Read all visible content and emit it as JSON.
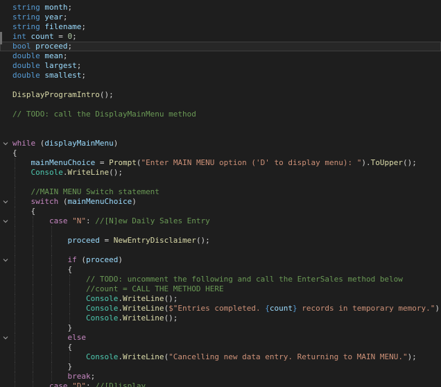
{
  "editor": {
    "background": "#1e1e1e",
    "colors": {
      "kw": "#569cd6",
      "ctl": "#c586c0",
      "var": "#9cdcfe",
      "fn": "#dcdcaa",
      "cls": "#4ec9b0",
      "com": "#6a9955",
      "str": "#ce9178",
      "num": "#b5cea8",
      "pun": "#d4d4d4"
    },
    "lines": [
      {
        "tokens": [
          {
            "t": "string",
            "c": "kw"
          },
          {
            "t": " month",
            "c": "var"
          },
          {
            "t": ";",
            "c": "pun"
          }
        ]
      },
      {
        "tokens": [
          {
            "t": "string",
            "c": "kw"
          },
          {
            "t": " year",
            "c": "var"
          },
          {
            "t": ";",
            "c": "pun"
          }
        ]
      },
      {
        "tokens": [
          {
            "t": "string",
            "c": "kw"
          },
          {
            "t": " filename",
            "c": "var"
          },
          {
            "t": ";",
            "c": "pun"
          }
        ]
      },
      {
        "tokens": [
          {
            "t": "int",
            "c": "kw"
          },
          {
            "t": " count",
            "c": "var"
          },
          {
            "t": " = ",
            "c": "pun"
          },
          {
            "t": "0",
            "c": "num"
          },
          {
            "t": ";",
            "c": "pun"
          }
        ]
      },
      {
        "highlight": true,
        "tokens": [
          {
            "t": "bool",
            "c": "kw"
          },
          {
            "t": " proceed",
            "c": "var"
          },
          {
            "t": ";",
            "c": "pun"
          }
        ]
      },
      {
        "tokens": [
          {
            "t": "double",
            "c": "kw"
          },
          {
            "t": " mean",
            "c": "var"
          },
          {
            "t": ";",
            "c": "pun"
          }
        ]
      },
      {
        "tokens": [
          {
            "t": "double",
            "c": "kw"
          },
          {
            "t": " largest",
            "c": "var"
          },
          {
            "t": ";",
            "c": "pun"
          }
        ]
      },
      {
        "tokens": [
          {
            "t": "double",
            "c": "kw"
          },
          {
            "t": " smallest",
            "c": "var"
          },
          {
            "t": ";",
            "c": "pun"
          }
        ]
      },
      {
        "tokens": []
      },
      {
        "tokens": [
          {
            "t": "DisplayProgramIntro",
            "c": "fn"
          },
          {
            "t": "();",
            "c": "pun"
          }
        ]
      },
      {
        "tokens": []
      },
      {
        "tokens": [
          {
            "t": "// TODO: call the DisplayMainMenu method",
            "c": "com"
          }
        ]
      },
      {
        "tokens": []
      },
      {
        "tokens": []
      },
      {
        "fold": true,
        "tokens": [
          {
            "t": "while",
            "c": "ctl"
          },
          {
            "t": " (",
            "c": "pun"
          },
          {
            "t": "displayMainMenu",
            "c": "var"
          },
          {
            "t": ")",
            "c": "pun"
          }
        ]
      },
      {
        "tokens": [
          {
            "t": "{",
            "c": "pun"
          }
        ]
      },
      {
        "indent": 4,
        "guides": 1,
        "tokens": [
          {
            "t": "mainMenuChoice",
            "c": "var"
          },
          {
            "t": " = ",
            "c": "pun"
          },
          {
            "t": "Prompt",
            "c": "fn"
          },
          {
            "t": "(",
            "c": "pun"
          },
          {
            "t": "\"Enter MAIN MENU option ('D' to display menu): \"",
            "c": "str"
          },
          {
            "t": ").",
            "c": "pun"
          },
          {
            "t": "ToUpper",
            "c": "fn"
          },
          {
            "t": "();",
            "c": "pun"
          }
        ]
      },
      {
        "indent": 4,
        "guides": 1,
        "tokens": [
          {
            "t": "Console",
            "c": "cls"
          },
          {
            "t": ".",
            "c": "pun"
          },
          {
            "t": "WriteLine",
            "c": "fn"
          },
          {
            "t": "();",
            "c": "pun"
          }
        ]
      },
      {
        "guides": 1,
        "tokens": []
      },
      {
        "indent": 4,
        "guides": 1,
        "tokens": [
          {
            "t": "//MAIN MENU Switch statement",
            "c": "com"
          }
        ]
      },
      {
        "indent": 4,
        "guides": 1,
        "fold": true,
        "tokens": [
          {
            "t": "switch",
            "c": "ctl"
          },
          {
            "t": " (",
            "c": "pun"
          },
          {
            "t": "mainMenuChoice",
            "c": "var"
          },
          {
            "t": ")",
            "c": "pun"
          }
        ]
      },
      {
        "indent": 4,
        "guides": 1,
        "tokens": [
          {
            "t": "{",
            "c": "pun"
          }
        ]
      },
      {
        "indent": 8,
        "guides": 2,
        "fold": true,
        "tokens": [
          {
            "t": "case",
            "c": "ctl"
          },
          {
            "t": " \"N\"",
            "c": "str"
          },
          {
            "t": ": ",
            "c": "pun"
          },
          {
            "t": "//[N]ew Daily Sales Entry",
            "c": "com"
          }
        ]
      },
      {
        "guides": 3,
        "tokens": []
      },
      {
        "indent": 12,
        "guides": 3,
        "tokens": [
          {
            "t": "proceed",
            "c": "var"
          },
          {
            "t": " = ",
            "c": "pun"
          },
          {
            "t": "NewEntryDisclaimer",
            "c": "fn"
          },
          {
            "t": "();",
            "c": "pun"
          }
        ]
      },
      {
        "guides": 3,
        "tokens": []
      },
      {
        "indent": 12,
        "guides": 3,
        "fold": true,
        "tokens": [
          {
            "t": "if",
            "c": "ctl"
          },
          {
            "t": " (",
            "c": "pun"
          },
          {
            "t": "proceed",
            "c": "var"
          },
          {
            "t": ")",
            "c": "pun"
          }
        ]
      },
      {
        "indent": 12,
        "guides": 3,
        "tokens": [
          {
            "t": "{",
            "c": "pun"
          }
        ]
      },
      {
        "indent": 16,
        "guides": 4,
        "tokens": [
          {
            "t": "// TODO: uncomment the following and call the EnterSales method below",
            "c": "com"
          }
        ]
      },
      {
        "indent": 16,
        "guides": 4,
        "tokens": [
          {
            "t": "//count = CALL THE METHOD HERE",
            "c": "com"
          }
        ]
      },
      {
        "indent": 16,
        "guides": 4,
        "tokens": [
          {
            "t": "Console",
            "c": "cls"
          },
          {
            "t": ".",
            "c": "pun"
          },
          {
            "t": "WriteLine",
            "c": "fn"
          },
          {
            "t": "();",
            "c": "pun"
          }
        ]
      },
      {
        "indent": 16,
        "guides": 4,
        "tokens": [
          {
            "t": "Console",
            "c": "cls"
          },
          {
            "t": ".",
            "c": "pun"
          },
          {
            "t": "WriteLine",
            "c": "fn"
          },
          {
            "t": "(",
            "c": "pun"
          },
          {
            "t": "$\"Entries completed. ",
            "c": "str"
          },
          {
            "t": "{",
            "c": "kw"
          },
          {
            "t": "count",
            "c": "var"
          },
          {
            "t": "}",
            "c": "kw"
          },
          {
            "t": " records in temporary memory.\"",
            "c": "str"
          },
          {
            "t": ");",
            "c": "pun"
          }
        ]
      },
      {
        "indent": 16,
        "guides": 4,
        "tokens": [
          {
            "t": "Console",
            "c": "cls"
          },
          {
            "t": ".",
            "c": "pun"
          },
          {
            "t": "WriteLine",
            "c": "fn"
          },
          {
            "t": "();",
            "c": "pun"
          }
        ]
      },
      {
        "indent": 12,
        "guides": 3,
        "tokens": [
          {
            "t": "}",
            "c": "pun"
          }
        ]
      },
      {
        "indent": 12,
        "guides": 3,
        "fold": true,
        "tokens": [
          {
            "t": "else",
            "c": "ctl"
          }
        ]
      },
      {
        "indent": 12,
        "guides": 3,
        "tokens": [
          {
            "t": "{",
            "c": "pun"
          }
        ]
      },
      {
        "indent": 16,
        "guides": 4,
        "tokens": [
          {
            "t": "Console",
            "c": "cls"
          },
          {
            "t": ".",
            "c": "pun"
          },
          {
            "t": "WriteLine",
            "c": "fn"
          },
          {
            "t": "(",
            "c": "pun"
          },
          {
            "t": "\"Cancelling new data entry. Returning to MAIN MENU.\"",
            "c": "str"
          },
          {
            "t": ");",
            "c": "pun"
          }
        ]
      },
      {
        "indent": 12,
        "guides": 3,
        "tokens": [
          {
            "t": "}",
            "c": "pun"
          }
        ]
      },
      {
        "indent": 12,
        "guides": 3,
        "tokens": [
          {
            "t": "break",
            "c": "ctl"
          },
          {
            "t": ";",
            "c": "pun"
          }
        ]
      },
      {
        "indent": 8,
        "guides": 2,
        "tokens": [
          {
            "t": "case",
            "c": "ctl"
          },
          {
            "t": " \"D\"",
            "c": "str"
          },
          {
            "t": ": ",
            "c": "pun"
          },
          {
            "t": "//[D]isplay",
            "c": "com"
          }
        ]
      }
    ]
  }
}
